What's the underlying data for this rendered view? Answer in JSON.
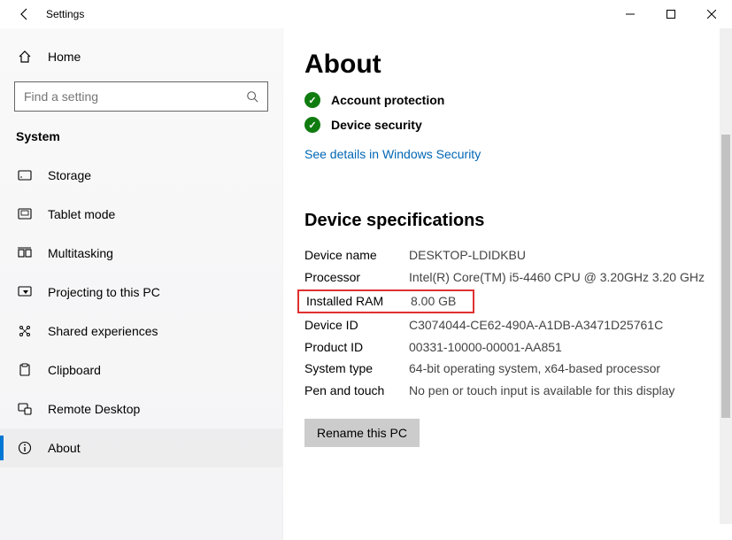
{
  "window": {
    "title": "Settings"
  },
  "sidebar": {
    "home_label": "Home",
    "search_placeholder": "Find a setting",
    "section_label": "System",
    "items": [
      {
        "label": "Storage"
      },
      {
        "label": "Tablet mode"
      },
      {
        "label": "Multitasking"
      },
      {
        "label": "Projecting to this PC"
      },
      {
        "label": "Shared experiences"
      },
      {
        "label": "Clipboard"
      },
      {
        "label": "Remote Desktop"
      },
      {
        "label": "About"
      }
    ]
  },
  "content": {
    "page_title": "About",
    "status": [
      {
        "label": "Account protection"
      },
      {
        "label": "Device security"
      }
    ],
    "security_link": "See details in Windows Security",
    "specs_title": "Device specifications",
    "specs": {
      "device_name_label": "Device name",
      "device_name_value": "DESKTOP-LDIDKBU",
      "processor_label": "Processor",
      "processor_value": "Intel(R) Core(TM) i5-4460  CPU @ 3.20GHz   3.20 GHz",
      "ram_label": "Installed RAM",
      "ram_value": "8.00 GB",
      "device_id_label": "Device ID",
      "device_id_value": "C3074044-CE62-490A-A1DB-A3471D25761C",
      "product_id_label": "Product ID",
      "product_id_value": "00331-10000-00001-AA851",
      "system_type_label": "System type",
      "system_type_value": "64-bit operating system, x64-based processor",
      "pen_touch_label": "Pen and touch",
      "pen_touch_value": "No pen or touch input is available for this display"
    },
    "rename_button": "Rename this PC"
  }
}
